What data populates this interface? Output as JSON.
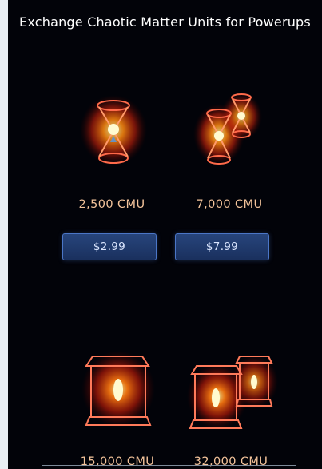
{
  "header": {
    "title": "Exchange Chaotic Matter Units for Powerups"
  },
  "packs": [
    {
      "amount": "2,500 CMU",
      "price": "$2.99"
    },
    {
      "amount": "7,000 CMU",
      "price": "$7.99"
    },
    {
      "amount": "15,000 CMU"
    },
    {
      "amount": "32,000 CMU"
    }
  ],
  "icons": {
    "pack_1": "single-hourglass-canister-icon",
    "pack_2": "double-hourglass-canister-icon",
    "pack_3": "large-lantern-canister-icon",
    "pack_4": "double-lantern-canister-icon"
  },
  "colors": {
    "background": "#020309",
    "price_text": "#f4c49b",
    "button_fill": "#27457c",
    "button_border": "#4b76c7",
    "glow": "#ff4a10"
  }
}
